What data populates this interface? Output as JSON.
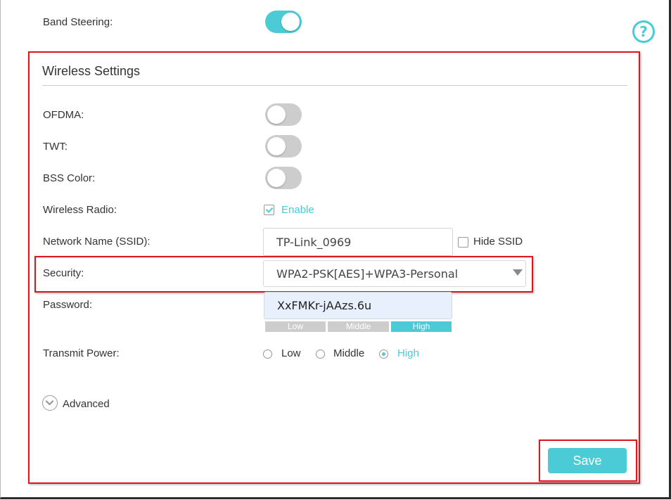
{
  "band_steering": {
    "label": "Band Steering:",
    "enabled": true
  },
  "help_icon": "question-circle-icon",
  "wireless_settings": {
    "title": "Wireless Settings",
    "ofdma": {
      "label": "OFDMA:",
      "enabled": false
    },
    "twt": {
      "label": "TWT:",
      "enabled": false
    },
    "bss_color": {
      "label": "BSS Color:",
      "enabled": false
    },
    "wireless_radio": {
      "label": "Wireless Radio:",
      "checkbox_label": "Enable",
      "checked": true
    },
    "network_name": {
      "label": "Network Name (SSID):",
      "value": "TP-Link_0969",
      "hide_ssid_label": "Hide SSID",
      "hide_ssid_checked": false
    },
    "security": {
      "label": "Security:",
      "selected": "WPA2-PSK[AES]+WPA3-Personal"
    },
    "password": {
      "label": "Password:",
      "value": "XxFMKr-jAAzs.6u",
      "strength_levels": [
        "Low",
        "Middle",
        "High"
      ],
      "strength": "High"
    },
    "transmit_power": {
      "label": "Transmit Power:",
      "options": [
        "Low",
        "Middle",
        "High"
      ],
      "selected": "High"
    },
    "advanced": {
      "label": "Advanced",
      "icon": "chevron-down-circle-icon"
    },
    "save_label": "Save"
  },
  "colors": {
    "accent": "#4acbd6",
    "highlight_box": "#e0161e",
    "toggle_off": "#cdcdcd"
  }
}
